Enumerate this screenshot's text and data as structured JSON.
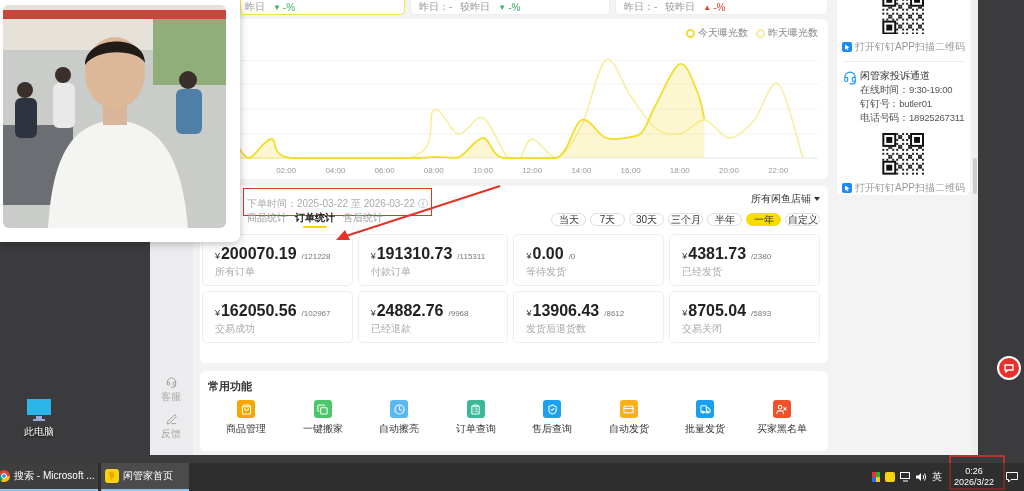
{
  "desktop": {
    "icons": [
      {
        "label": "此电脑"
      }
    ]
  },
  "browser": {
    "sidebar": {
      "items": [
        {
          "label": "客服"
        },
        {
          "label": "反馈"
        }
      ]
    },
    "summary_cards": [
      {
        "selected": true,
        "compare_label": "昨日",
        "rising": false,
        "arrow": "▼",
        "change": "-%"
      },
      {
        "selected": false,
        "yesterday_label": "昨日：",
        "yesterday_value": "-",
        "compare_label": "较昨日",
        "rising": false,
        "arrow": "▼",
        "change": "-%"
      },
      {
        "selected": false,
        "yesterday_label": "昨日：",
        "yesterday_value": "-",
        "compare_label": "较昨日",
        "rising": true,
        "arrow": "▲",
        "change": "-%"
      }
    ],
    "exposure_chart": {
      "legend": [
        {
          "label": "今天曝光数",
          "color": "#f2dc2c"
        },
        {
          "label": "昨天曝光数",
          "color": "#f7ee9c"
        }
      ],
      "x_labels": [
        "02:00",
        "04:00",
        "06:00",
        "08:00",
        "10:00",
        "12:00",
        "14:00",
        "16:00",
        "18:00",
        "20:00",
        "22:00"
      ]
    },
    "orders": {
      "date_label": "下单时间：",
      "date_range": "2025-03-22 至 2026-03-22",
      "info_icon": "ⓘ",
      "store_filter": "所有闲鱼店铺",
      "tabs": [
        {
          "label": "商品统计",
          "selected": false
        },
        {
          "label": "订单统计",
          "selected": true
        },
        {
          "label": "售后统计",
          "selected": false
        }
      ],
      "ranges": [
        {
          "label": "当天",
          "selected": false
        },
        {
          "label": "7天",
          "selected": false
        },
        {
          "label": "30天",
          "selected": false
        },
        {
          "label": "三个月",
          "selected": false
        },
        {
          "label": "半年",
          "selected": false
        },
        {
          "label": "一年",
          "selected": true
        },
        {
          "label": "自定义",
          "selected": false
        }
      ],
      "stats": [
        {
          "currency": "¥",
          "amount": "200070.19",
          "count": "/121228",
          "label": "所有订单"
        },
        {
          "currency": "¥",
          "amount": "191310.73",
          "count": "/115311",
          "label": "付款订单"
        },
        {
          "currency": "¥",
          "amount": "0.00",
          "count": "/0",
          "label": "等待发货"
        },
        {
          "currency": "¥",
          "amount": "4381.73",
          "count": "/2380",
          "label": "已经发货"
        },
        {
          "currency": "¥",
          "amount": "162050.56",
          "count": "/102967",
          "label": "交易成功"
        },
        {
          "currency": "¥",
          "amount": "24882.76",
          "count": "/9968",
          "label": "已经退款"
        },
        {
          "currency": "¥",
          "amount": "13906.43",
          "count": "/8612",
          "label": "发货后退货数"
        },
        {
          "currency": "¥",
          "amount": "8705.04",
          "count": "/5893",
          "label": "交易关闭"
        }
      ]
    },
    "functions": {
      "title": "常用功能",
      "items": [
        {
          "label": "商品管理",
          "color": "#f7a600"
        },
        {
          "label": "一键搬家",
          "color": "#4cc66a"
        },
        {
          "label": "自动擦亮",
          "color": "#5bb8f0"
        },
        {
          "label": "订单查询",
          "color": "#3bb89a"
        },
        {
          "label": "售后查询",
          "color": "#1aa1f0"
        },
        {
          "label": "自动发货",
          "color": "#f8b216"
        },
        {
          "label": "批量发货",
          "color": "#1a9ef0"
        },
        {
          "label": "买家黑名单",
          "color": "#f0502a"
        }
      ]
    },
    "support": {
      "top_caption": "打开钉钉APP扫描二维码",
      "title": "闲管家投诉通道",
      "lines": [
        "在线时间：9:30-19:00",
        "钉钉号：butler01",
        "电话号码：18925267311"
      ],
      "bottom_caption": "打开钉钉APP扫描二维码"
    }
  },
  "taskbar": {
    "apps": [
      {
        "label": "搜索 - Microsoft ..."
      },
      {
        "label": "闲管家首页"
      }
    ],
    "ime": "英",
    "time": "0:26",
    "date": "2026/3/22"
  }
}
